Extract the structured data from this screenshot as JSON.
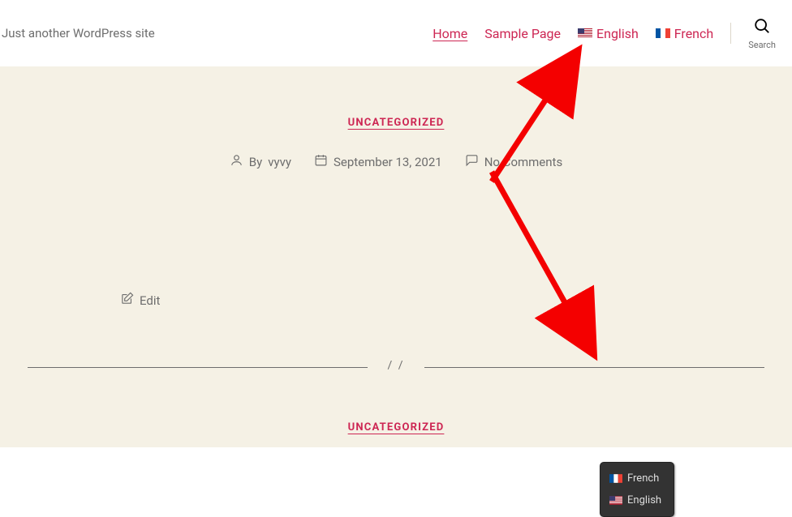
{
  "header": {
    "tagline": "Just another WordPress site",
    "nav": {
      "home": "Home",
      "sample": "Sample Page",
      "english": "English",
      "french": "French"
    },
    "search_label": "Search"
  },
  "post1": {
    "category": "UNCATEGORIZED",
    "by_prefix": "By",
    "author": "vyvy",
    "date": "September 13, 2021",
    "comments": "No Comments",
    "edit": "Edit"
  },
  "separator": "/ /",
  "post2": {
    "category": "UNCATEGORIZED"
  },
  "lang_switcher": {
    "french": "French",
    "english": "English"
  }
}
